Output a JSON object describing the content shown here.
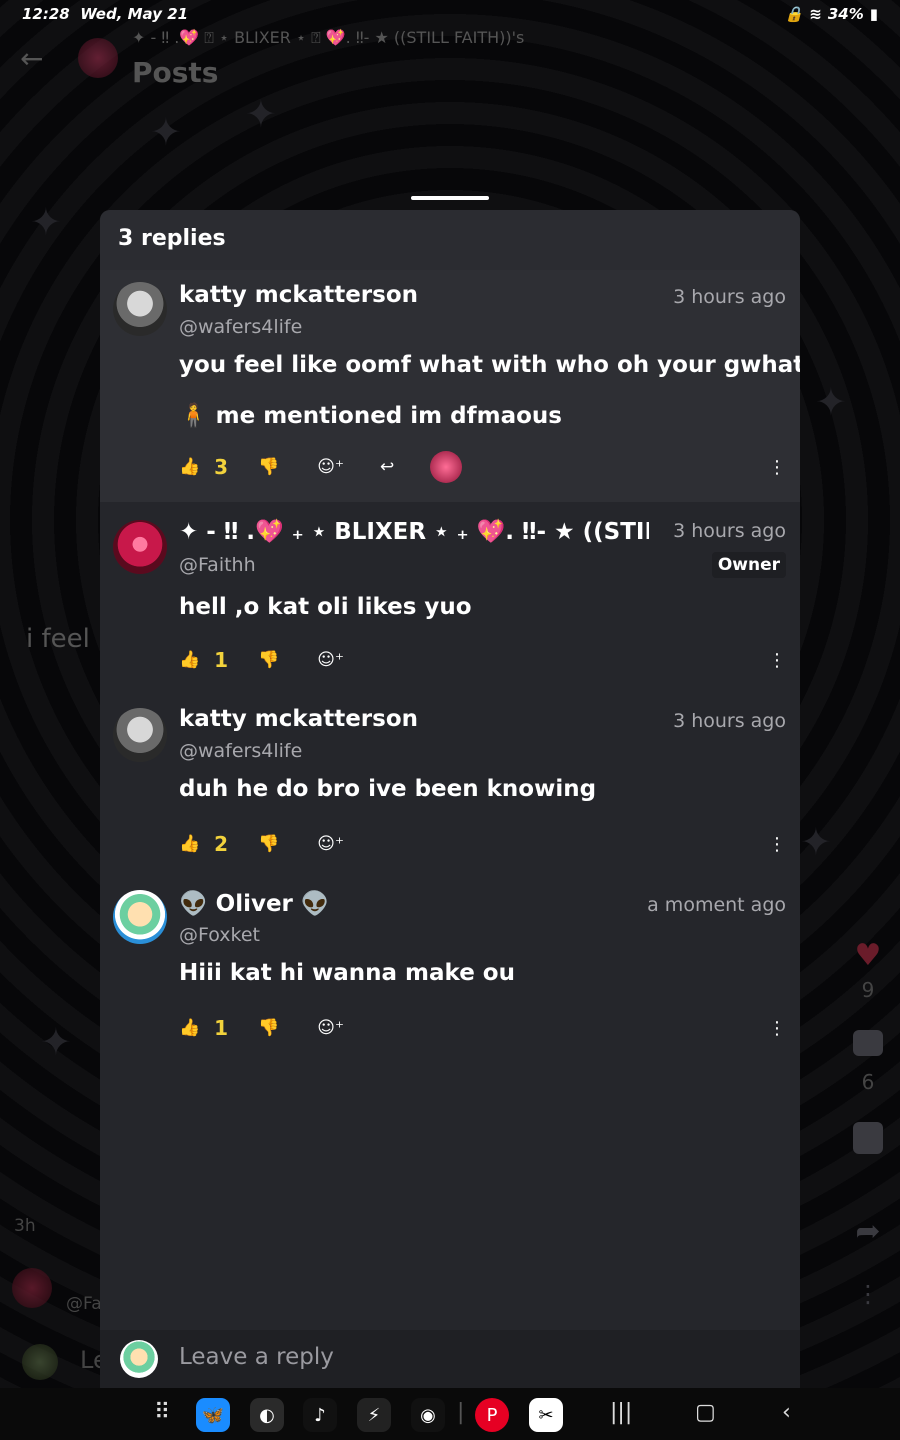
{
  "status": {
    "time": "12:28",
    "date": "Wed, May 21",
    "battery": "34%"
  },
  "header": {
    "subtitle": "✦ - ‼ .💖 ⍰ ⋆ BLIXER ⋆ ⍰ 💖. ‼- ★ ((STILL FAITH))'s",
    "title": "Posts"
  },
  "background": {
    "peek_text": "i feel",
    "peek_time": "3h",
    "peek_handle": "@Fa",
    "peek_reply": "Le",
    "heart_count": "9",
    "comment_count": "6"
  },
  "sheet": {
    "title": "3 replies",
    "replies": [
      {
        "name": "katty mckatterson",
        "handle": "@wafers4life",
        "time": "3 hours ago",
        "text_line1": "you feel like oomf what with who oh your gwhat",
        "text_line2": "🧍 me mentioned im dfmaous",
        "likes": "3"
      },
      {
        "name": "✦ - ‼ .💖 ₊ ⋆ BLIXER ⋆ ₊ 💖. ‼- ★ ((STILL",
        "handle": "@Faithh",
        "time": "3 hours ago",
        "badge": "Owner",
        "text": "hell ,o kat oli likes yuo",
        "likes": "1"
      },
      {
        "name": "katty mckatterson",
        "handle": "@wafers4life",
        "time": "3 hours ago",
        "text": "duh he do bro ive been knowing",
        "likes": "2"
      },
      {
        "name": "👽 Oliver 👽",
        "handle": "@Foxket",
        "time": "a moment ago",
        "text": "Hiii kat hi wanna make ou",
        "likes": "1"
      }
    ],
    "reply_placeholder": "Leave a reply"
  },
  "icons": {
    "like": "thumbs-up-icon",
    "dislike": "thumbs-down-icon",
    "react": "add-reaction-icon",
    "reply": "reply-arrow-icon",
    "more": "more-vertical-icon"
  },
  "colors": {
    "accent_yellow": "#f2d23c",
    "sheet_bg": "#25262b",
    "muted_text": "#a8a8ad"
  }
}
